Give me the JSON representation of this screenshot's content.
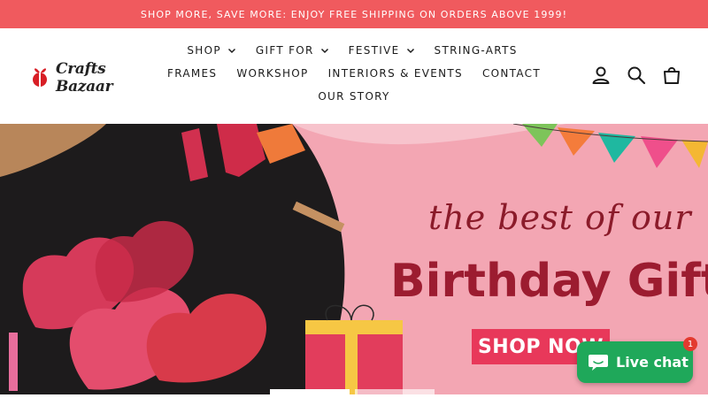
{
  "announcement": {
    "text": "SHOP MORE, SAVE MORE: ENJOY FREE SHIPPING ON ORDERS ABOVE 1999!"
  },
  "logo": {
    "text": "Crafts Bazaar"
  },
  "nav": {
    "row1": [
      {
        "label": "SHOP",
        "dropdown": true
      },
      {
        "label": "GIFT FOR",
        "dropdown": true
      },
      {
        "label": "FESTIVE",
        "dropdown": true
      },
      {
        "label": "STRING-ARTS",
        "dropdown": false
      }
    ],
    "row2": [
      {
        "label": "FRAMES"
      },
      {
        "label": "WORKSHOP"
      },
      {
        "label": "INTERIORS & EVENTS"
      },
      {
        "label": "CONTACT"
      }
    ],
    "row3": [
      {
        "label": "OUR STORY"
      }
    ]
  },
  "header_icons": [
    "account-icon",
    "search-icon",
    "cart-icon"
  ],
  "hero": {
    "line1": "the best of our",
    "line2": "Birthday Gifts",
    "cta": "SHOP NOW"
  },
  "chat": {
    "label": "Live chat",
    "badge": "1"
  },
  "colors": {
    "announcement_bg": "#f05a5e",
    "hero_pink": "#f3a6b3",
    "hero_text": "#9c1c30",
    "cta_bg": "#e8385a",
    "chat_bg": "#1fa85a"
  }
}
